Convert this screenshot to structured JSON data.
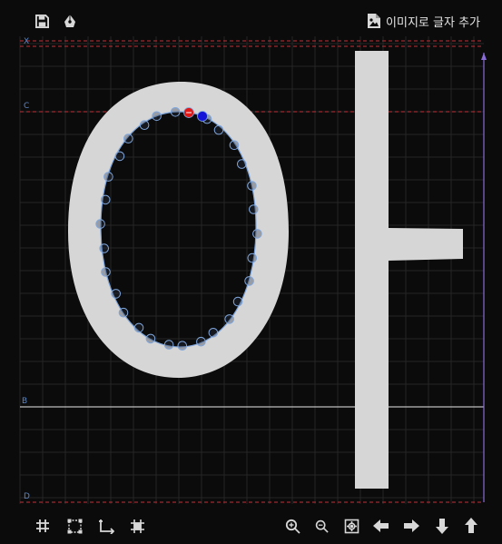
{
  "toolbar": {
    "save_icon": "save-icon",
    "pen_icon": "pen-nib-icon",
    "add_image_label": "이미지로 글자 추가",
    "add_image_icon": "image-file-icon"
  },
  "guides": {
    "x_label": "X",
    "c_label": "C",
    "b_label": "B",
    "d_label": "D"
  },
  "glyph": {
    "characters": "아"
  },
  "bottom_toolbar": {
    "left": [
      "grid-icon",
      "select-box-icon",
      "axis-icon",
      "grid-snap-icon"
    ],
    "right": [
      "zoom-in-icon",
      "zoom-out-icon",
      "fit-view-icon",
      "arrow-left-icon",
      "arrow-right-icon",
      "arrow-down-icon",
      "arrow-up-icon"
    ]
  },
  "colors": {
    "background": "#0b0b0b",
    "glyph_fill": "#d6d6d6",
    "guide_dashed": "#c2303a",
    "baseline": "#e8e8e8",
    "accent_purple": "#8a6cd8",
    "point_stroke": "#7fa6dc",
    "start_point": "#e01818",
    "selected_point": "#1515d8"
  }
}
